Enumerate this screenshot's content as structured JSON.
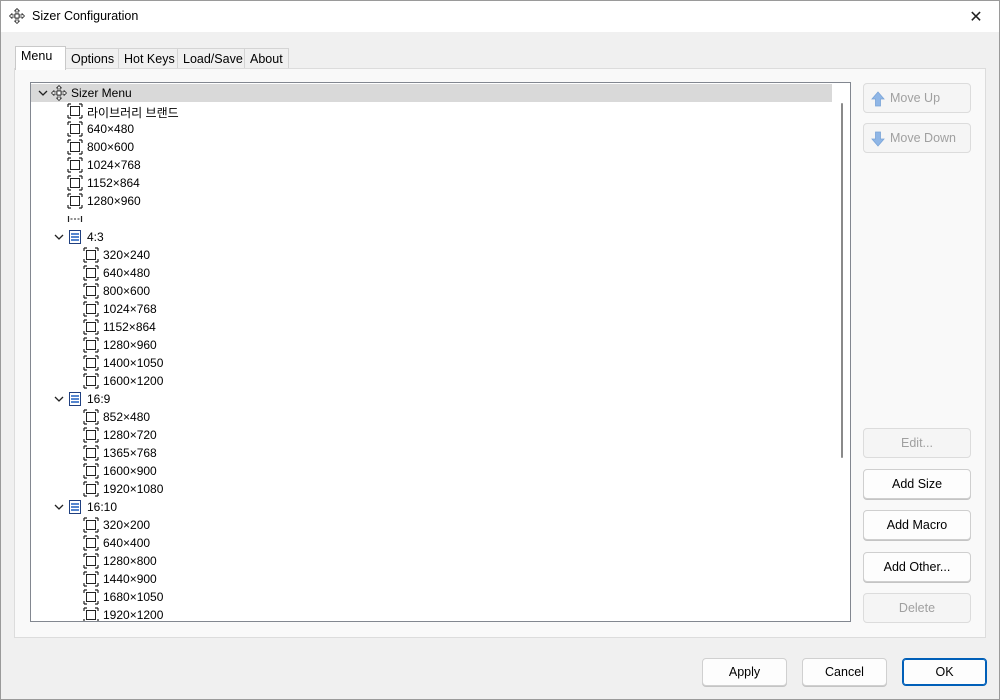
{
  "window": {
    "title": "Sizer Configuration",
    "close_glyph": "✕"
  },
  "tabs": [
    {
      "label": "Menu",
      "active": true
    },
    {
      "label": "Options",
      "active": false
    },
    {
      "label": "Hot Keys",
      "active": false
    },
    {
      "label": "Load/Save",
      "active": false
    },
    {
      "label": "About",
      "active": false
    }
  ],
  "tree": {
    "rows": [
      {
        "label": "Sizer Menu",
        "level": 0,
        "icon": "sizer-move-icon",
        "expanded": true,
        "selected": true
      },
      {
        "label": "라이브러리 브랜드",
        "level": 1,
        "icon": "size-icon"
      },
      {
        "label": "640×480",
        "level": 1,
        "icon": "size-icon"
      },
      {
        "label": "800×600",
        "level": 1,
        "icon": "size-icon"
      },
      {
        "label": "1024×768",
        "level": 1,
        "icon": "size-icon"
      },
      {
        "label": "1152×864",
        "level": 1,
        "icon": "size-icon"
      },
      {
        "label": "1280×960",
        "level": 1,
        "icon": "size-icon"
      },
      {
        "label": "",
        "level": 1,
        "icon": "separator-icon"
      },
      {
        "label": "4:3",
        "level": 1,
        "icon": "submenu-icon",
        "expanded": true
      },
      {
        "label": "320×240",
        "level": 2,
        "icon": "size-icon"
      },
      {
        "label": "640×480",
        "level": 2,
        "icon": "size-icon"
      },
      {
        "label": "800×600",
        "level": 2,
        "icon": "size-icon"
      },
      {
        "label": "1024×768",
        "level": 2,
        "icon": "size-icon"
      },
      {
        "label": "1152×864",
        "level": 2,
        "icon": "size-icon"
      },
      {
        "label": "1280×960",
        "level": 2,
        "icon": "size-icon"
      },
      {
        "label": "1400×1050",
        "level": 2,
        "icon": "size-icon"
      },
      {
        "label": "1600×1200",
        "level": 2,
        "icon": "size-icon"
      },
      {
        "label": "16:9",
        "level": 1,
        "icon": "submenu-icon",
        "expanded": true
      },
      {
        "label": "852×480",
        "level": 2,
        "icon": "size-icon"
      },
      {
        "label": "1280×720",
        "level": 2,
        "icon": "size-icon"
      },
      {
        "label": "1365×768",
        "level": 2,
        "icon": "size-icon"
      },
      {
        "label": "1600×900",
        "level": 2,
        "icon": "size-icon"
      },
      {
        "label": "1920×1080",
        "level": 2,
        "icon": "size-icon"
      },
      {
        "label": "16:10",
        "level": 1,
        "icon": "submenu-icon",
        "expanded": true
      },
      {
        "label": "320×200",
        "level": 2,
        "icon": "size-icon"
      },
      {
        "label": "640×400",
        "level": 2,
        "icon": "size-icon"
      },
      {
        "label": "1280×800",
        "level": 2,
        "icon": "size-icon"
      },
      {
        "label": "1440×900",
        "level": 2,
        "icon": "size-icon"
      },
      {
        "label": "1680×1050",
        "level": 2,
        "icon": "size-icon"
      },
      {
        "label": "1920×1200",
        "level": 2,
        "icon": "size-icon"
      }
    ]
  },
  "side_buttons": {
    "move_up": {
      "label": "Move Up",
      "enabled": false
    },
    "move_down": {
      "label": "Move Down",
      "enabled": false
    },
    "edit": {
      "label": "Edit...",
      "enabled": false
    },
    "add_size": {
      "label": "Add Size",
      "enabled": true
    },
    "add_macro": {
      "label": "Add Macro",
      "enabled": true
    },
    "add_other": {
      "label": "Add Other...",
      "enabled": true
    },
    "delete": {
      "label": "Delete",
      "enabled": false
    }
  },
  "dialog_buttons": {
    "apply": "Apply",
    "cancel": "Cancel",
    "ok": "OK"
  },
  "colors": {
    "accent": "#005fb8",
    "selection": "#d9d9d9",
    "submenu_icon": "#1f5fbf",
    "arrow_disabled": "#8fb6e6"
  }
}
